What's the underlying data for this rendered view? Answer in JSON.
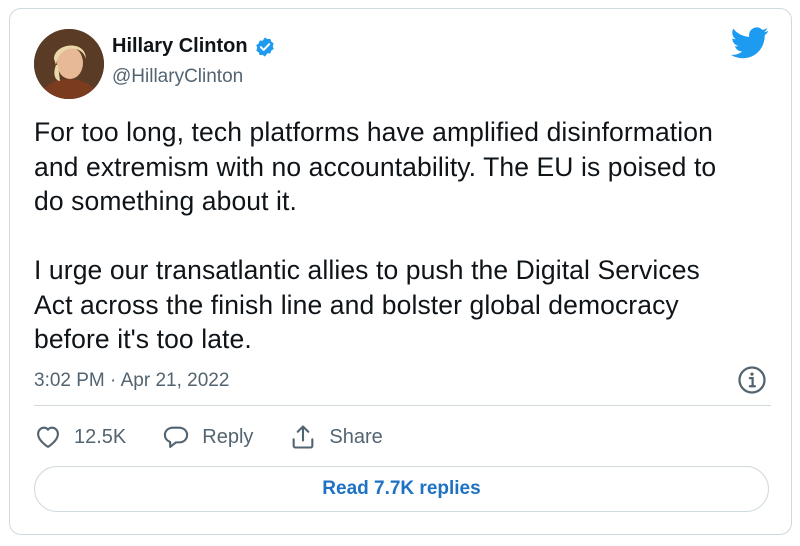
{
  "author": {
    "display_name": "Hillary Clinton",
    "handle": "@HillaryClinton"
  },
  "tweet": {
    "paragraph_1": "For too long, tech platforms have amplified disinformation\nand extremism with no accountability. The EU is poised to\ndo something about it.",
    "paragraph_2": "I urge our transatlantic allies to push the Digital Services\nAct across the finish line and bolster global democracy\nbefore it's too late.",
    "timestamp": "3:02 PM · Apr 21, 2022"
  },
  "actions": {
    "like_count": "12.5K",
    "reply_label": "Reply",
    "share_label": "Share"
  },
  "replies_button": "Read 7.7K replies",
  "colors": {
    "brand_blue": "#1d9bf0",
    "link_blue": "#1d72c4",
    "text": "#0f1419",
    "muted": "#536471",
    "border": "#cfd9de"
  },
  "icons": [
    "verified-badge-icon",
    "twitter-bird-icon",
    "info-icon",
    "heart-icon",
    "reply-icon",
    "share-icon"
  ]
}
